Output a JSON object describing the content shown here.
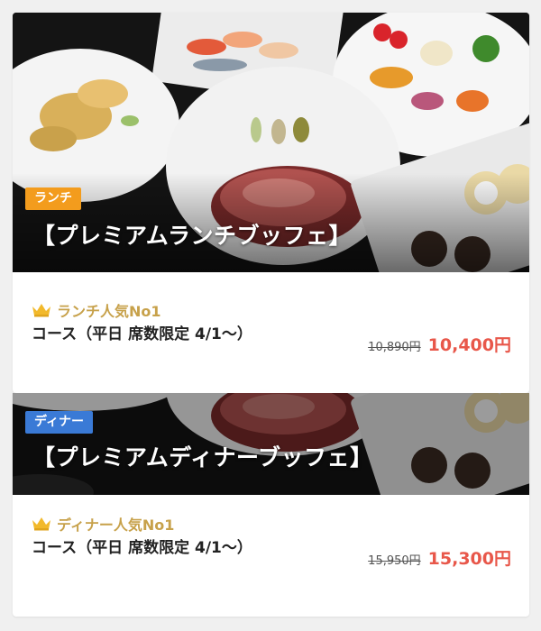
{
  "colors": {
    "lunch_badge": "#f39c1d",
    "dinner_badge": "#3a7ad6",
    "popular_gold": "#c7a14a",
    "sale_price": "#e8574a"
  },
  "plans": [
    {
      "badge": "ランチ",
      "title": "【プレミアムランチブッフェ】",
      "popular": "ランチ人気No1",
      "course": "コース（平日 席数限定 4/1〜）",
      "old_price": "10,890円",
      "new_price": "10,400円",
      "icon": "crown-icon"
    },
    {
      "badge": "ディナー",
      "title": "【プレミアムディナーブッフェ】",
      "popular": "ディナー人気No1",
      "course": "コース（平日 席数限定 4/1〜）",
      "old_price": "15,950円",
      "new_price": "15,300円",
      "icon": "crown-icon"
    }
  ]
}
